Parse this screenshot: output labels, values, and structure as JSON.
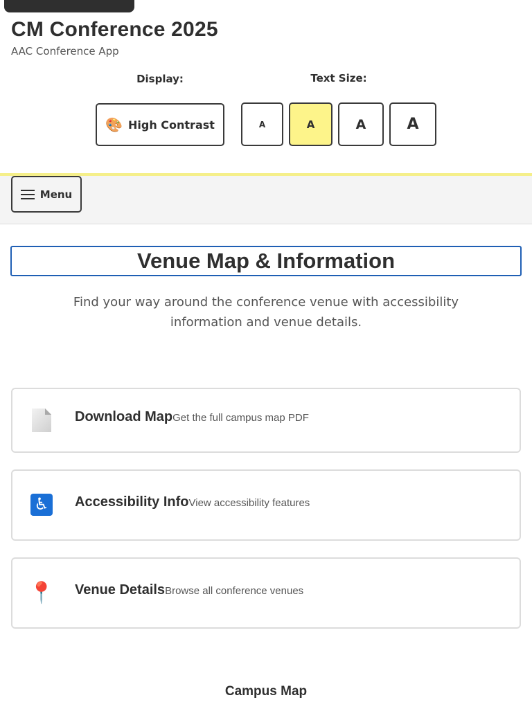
{
  "header": {
    "title": "CM Conference 2025",
    "subtitle": "AAC Conference App"
  },
  "controls": {
    "display_label": "Display:",
    "contrast_button": "High Contrast",
    "contrast_icon": "palette-icon",
    "text_size_label": "Text Size:",
    "sizes": [
      {
        "label": "A",
        "selected": false
      },
      {
        "label": "A",
        "selected": true
      },
      {
        "label": "A",
        "selected": false
      },
      {
        "label": "A",
        "selected": false
      }
    ],
    "selected_color": "#fdf48a"
  },
  "nav": {
    "menu_label": "Menu",
    "menu_icon": "hamburger-icon"
  },
  "main": {
    "title": "Venue Map & Information",
    "intro": "Find your way around the conference venue with accessibility information and venue details.",
    "cards": [
      {
        "icon": "document-icon",
        "label": "Download Map",
        "desc": "Get the full campus map PDF"
      },
      {
        "icon": "wheelchair-icon",
        "label": "Accessibility Info",
        "desc": "View accessibility features"
      },
      {
        "icon": "pushpin-icon",
        "label": "Venue Details",
        "desc": "Browse all conference venues"
      }
    ],
    "section_title": "Campus Map"
  },
  "colors": {
    "focus_outline": "#1f5fb4",
    "accent_line": "#f5ef8a"
  }
}
